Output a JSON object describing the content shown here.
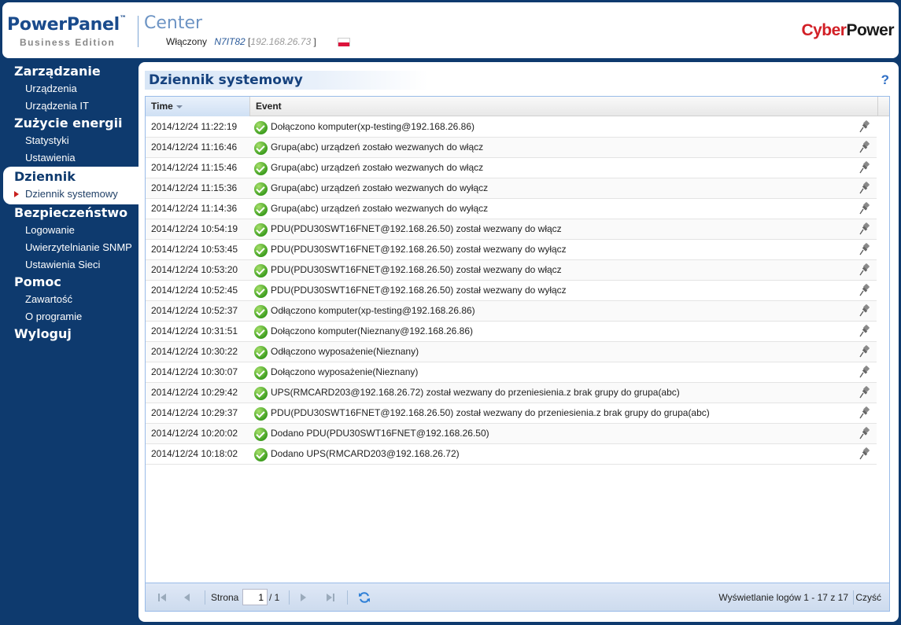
{
  "header": {
    "logo_main": "PowerPanel",
    "logo_tm": "™",
    "logo_sub": "Business Edition",
    "logo_center": "Center",
    "status": "Włączony",
    "hostname": "N7IT82",
    "ip": "192.168.26.73",
    "bracket_open": " [",
    "bracket_close": " ]",
    "brand_red": "Cyber",
    "brand_black": "Power"
  },
  "sidebar": {
    "sections": [
      {
        "title": "Zarządzanie",
        "items": [
          "Urządzenia",
          "Urządzenia IT"
        ]
      },
      {
        "title": "Zużycie energii",
        "items": [
          "Statystyki",
          "Ustawienia"
        ]
      },
      {
        "title": "Dziennik",
        "items": [
          "Dziennik systemowy"
        ]
      },
      {
        "title": "Bezpieczeństwo",
        "items": [
          "Logowanie",
          "Uwierzytelnianie SNMP",
          "Ustawienia Sieci"
        ]
      },
      {
        "title": "Pomoc",
        "items": [
          "Zawartość",
          "O programie"
        ]
      },
      {
        "title": "Wyloguj",
        "items": []
      }
    ]
  },
  "panel": {
    "title": "Dziennik systemowy",
    "help": "?"
  },
  "grid": {
    "col_time": "Time",
    "col_event": "Event",
    "rows": [
      {
        "time": "2014/12/24 11:22:19",
        "event": "Dołączono komputer(xp-testing@192.168.26.86)"
      },
      {
        "time": "2014/12/24 11:16:46",
        "event": "Grupa(abc) urządzeń zostało wezwanych do włącz"
      },
      {
        "time": "2014/12/24 11:15:46",
        "event": "Grupa(abc) urządzeń zostało wezwanych do włącz"
      },
      {
        "time": "2014/12/24 11:15:36",
        "event": "Grupa(abc) urządzeń zostało wezwanych do wyłącz"
      },
      {
        "time": "2014/12/24 11:14:36",
        "event": "Grupa(abc) urządzeń zostało wezwanych do wyłącz"
      },
      {
        "time": "2014/12/24 10:54:19",
        "event": "PDU(PDU30SWT16FNET@192.168.26.50) został wezwany do włącz"
      },
      {
        "time": "2014/12/24 10:53:45",
        "event": "PDU(PDU30SWT16FNET@192.168.26.50) został wezwany do wyłącz"
      },
      {
        "time": "2014/12/24 10:53:20",
        "event": "PDU(PDU30SWT16FNET@192.168.26.50) został wezwany do włącz"
      },
      {
        "time": "2014/12/24 10:52:45",
        "event": "PDU(PDU30SWT16FNET@192.168.26.50) został wezwany do wyłącz"
      },
      {
        "time": "2014/12/24 10:52:37",
        "event": "Odłączono komputer(xp-testing@192.168.26.86)"
      },
      {
        "time": "2014/12/24 10:31:51",
        "event": "Dołączono komputer(Nieznany@192.168.26.86)"
      },
      {
        "time": "2014/12/24 10:30:22",
        "event": "Odłączono wyposażenie(Nieznany)"
      },
      {
        "time": "2014/12/24 10:30:07",
        "event": "Dołączono wyposażenie(Nieznany)"
      },
      {
        "time": "2014/12/24 10:29:42",
        "event": "UPS(RMCARD203@192.168.26.72) został wezwany do przeniesienia.z brak grupy do grupa(abc)"
      },
      {
        "time": "2014/12/24 10:29:37",
        "event": "PDU(PDU30SWT16FNET@192.168.26.50) został wezwany do przeniesienia.z brak grupy do grupa(abc)"
      },
      {
        "time": "2014/12/24 10:20:02",
        "event": "Dodano PDU(PDU30SWT16FNET@192.168.26.50)"
      },
      {
        "time": "2014/12/24 10:18:02",
        "event": "Dodano UPS(RMCARD203@192.168.26.72)"
      }
    ]
  },
  "toolbar": {
    "page_label": "Strona",
    "page_value": "1",
    "page_total": "/ 1",
    "display_info": "Wyświetlanie logów 1 - 17 z 17",
    "clear_label": "Czyść"
  }
}
